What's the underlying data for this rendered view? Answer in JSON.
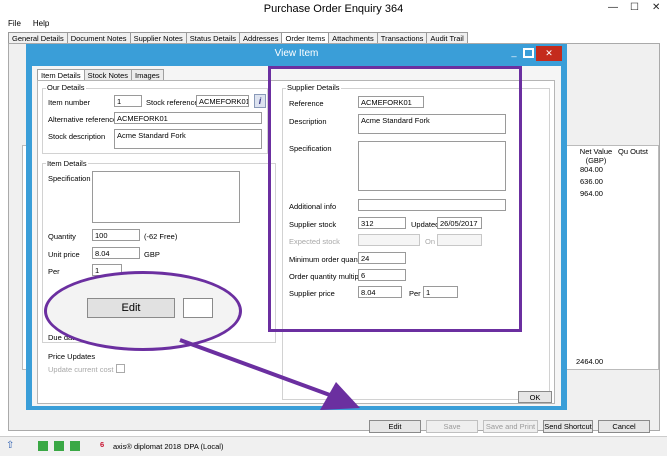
{
  "window": {
    "title": "Purchase Order Enquiry 364",
    "minimize": "—",
    "maximize": "☐",
    "close": "✕"
  },
  "menu": [
    "File",
    "Help"
  ],
  "outer_tabs": [
    "General Details",
    "Document Notes",
    "Supplier Notes",
    "Status Details",
    "Addresses",
    "Order Items",
    "Attachments",
    "Transactions",
    "Audit Trail"
  ],
  "grid": {
    "col_net_value": "Net Value (GBP)",
    "col_qty": "Qu Outst",
    "values": [
      "804.00",
      "636.00",
      "964.00"
    ],
    "total": "2464.00"
  },
  "bottom_buttons": {
    "edit": "Edit",
    "save": "Save",
    "save_print": "Save and Print",
    "send_shortcut": "Send Shortcut",
    "cancel": "Cancel"
  },
  "status": {
    "app": "axis® diplomat 2018",
    "db": "DPA (Local)"
  },
  "dialog": {
    "title": "View Item",
    "tabs": [
      "Item Details",
      "Stock Notes",
      "Images"
    ],
    "our_details": {
      "title": "Our Details",
      "item_number_label": "Item number",
      "item_number": "1",
      "stock_ref_label": "Stock reference",
      "stock_ref": "ACMEFORK01",
      "alt_ref_label": "Alternative reference",
      "alt_ref": "ACMEFORK01",
      "stock_desc_label": "Stock description",
      "stock_desc": "Acme Standard Fork"
    },
    "item_details": {
      "title": "Item Details",
      "spec_label": "Specification",
      "quantity_label": "Quantity",
      "quantity": "100",
      "quantity_note": "(-62 Free)",
      "unit_price_label": "Unit price",
      "unit_price": "8.04",
      "currency": "GBP",
      "per_label": "Per",
      "per": "1",
      "due_date_label": "Due date"
    },
    "price_updates": {
      "title": "Price Updates",
      "update_cost_label": "Update current cost"
    },
    "supplier": {
      "title": "Supplier Details",
      "reference_label": "Reference",
      "reference": "ACMEFORK01",
      "description_label": "Description",
      "description": "Acme Standard Fork",
      "spec_label": "Specification",
      "additional_label": "Additional info",
      "stock_label": "Supplier stock",
      "stock": "312",
      "updated_label": "Updated",
      "updated": "26/05/2017",
      "expected_label": "Expected stock",
      "on_label": "On",
      "min_qty_label": "Minimum order quantity",
      "min_qty": "24",
      "multiple_label": "Order quantity multiple",
      "multiple": "6",
      "price_label": "Supplier price",
      "price": "8.04",
      "per_label": "Per",
      "per": "1"
    },
    "ok_label": "OK",
    "zoom_edit_label": "Edit"
  },
  "colors": {
    "dialog_border": "#3a9ed8",
    "annotation": "#6b2fa0"
  }
}
